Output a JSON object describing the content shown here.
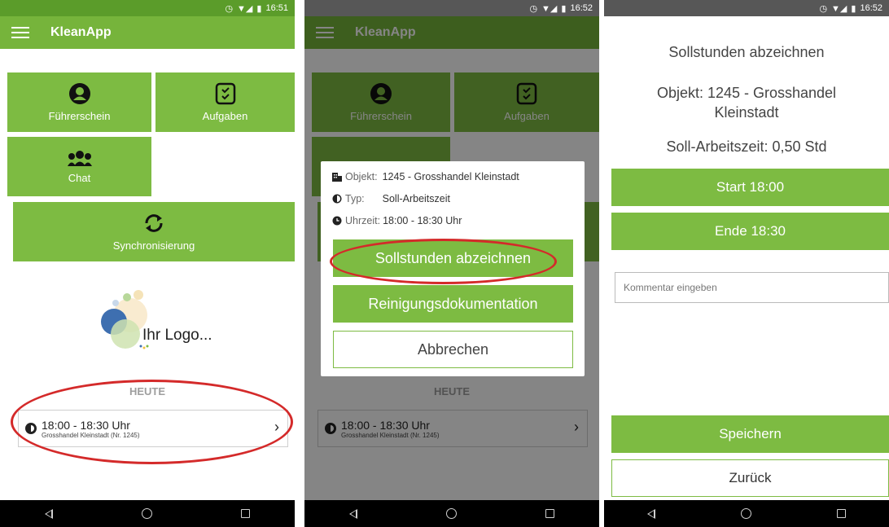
{
  "status": {
    "time1": "16:51",
    "time2": "16:52",
    "time3": "16:52"
  },
  "app": {
    "title": "KleanApp"
  },
  "tiles": {
    "fuehrerschein": "Führerschein",
    "aufgaben": "Aufgaben",
    "chat": "Chat",
    "sync": "Synchronisierung"
  },
  "logo": {
    "text": "Ihr Logo..."
  },
  "today": {
    "header": "HEUTE",
    "appointment": {
      "time": "18:00 - 18:30 Uhr",
      "place": "Grosshandel Kleinstadt (Nr. 1245)"
    }
  },
  "dialog": {
    "object_label": "Objekt:",
    "object_value": "1245 - Grosshandel Kleinstadt",
    "type_label": "Typ:",
    "type_value": "Soll-Arbeitszeit",
    "time_label": "Uhrzeit:",
    "time_value": "18:00 - 18:30 Uhr",
    "btn_sign": "Sollstunden abzeichnen",
    "btn_cleaning": "Reinigungsdokumentation",
    "btn_cancel": "Abbrechen"
  },
  "sign": {
    "title": "Sollstunden abzeichnen",
    "object_line1": "Objekt: 1245 - Grosshandel",
    "object_line2": "Kleinstadt",
    "target_time": "Soll-Arbeitszeit: 0,50 Std",
    "start_btn": "Start 18:00",
    "end_btn": "Ende 18:30",
    "comment_placeholder": "Kommentar eingeben",
    "save_btn": "Speichern",
    "back_btn": "Zurück"
  },
  "colors": {
    "primary": "#7dbb42",
    "appbar": "#76b43b",
    "statusbar": "#5b9c2a",
    "highlight": "#d42a2a"
  }
}
